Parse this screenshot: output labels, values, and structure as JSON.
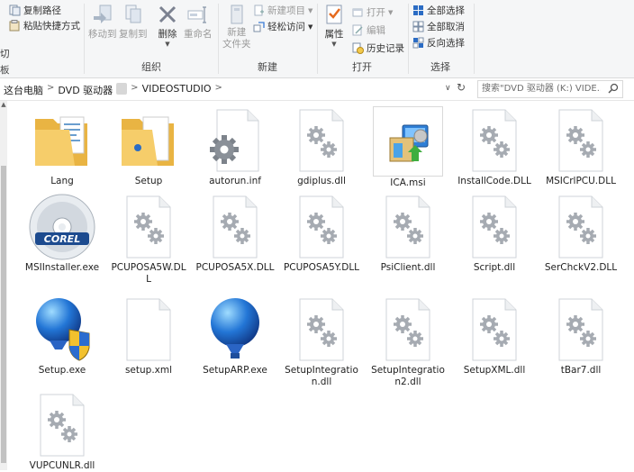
{
  "ribbon": {
    "clipboard": {
      "copy_path": "复制路径",
      "paste_shortcut": "粘贴快捷方式",
      "cut_partial": "切",
      "copy_partial": "板"
    },
    "organize": {
      "label": "组织",
      "move_to": "移动到",
      "copy_to": "复制到",
      "delete": "删除",
      "rename": "重命名"
    },
    "new": {
      "label": "新建",
      "new_folder": "新建\n文件夹",
      "new_item": "新建项目",
      "easy_access": "轻松访问"
    },
    "open": {
      "label": "打开",
      "properties": "属性",
      "open": "打开",
      "edit": "编辑",
      "history": "历史记录"
    },
    "select": {
      "label": "选择",
      "select_all": "全部选择",
      "select_none": "全部取消",
      "invert": "反向选择"
    }
  },
  "address": {
    "crumbs": [
      "这台电脑",
      "DVD 驱动器",
      "VIDEOSTUDIO"
    ],
    "search_placeholder": "搜索\"DVD 驱动器 (K:) VIDE..."
  },
  "files": [
    {
      "name": "Lang",
      "type": "folder-doc"
    },
    {
      "name": "Setup",
      "type": "folder-setup"
    },
    {
      "name": "autorun.inf",
      "type": "gear-large"
    },
    {
      "name": "gdiplus.dll",
      "type": "dll"
    },
    {
      "name": "ICA.msi",
      "type": "msi"
    },
    {
      "name": "InstallCode.DLL",
      "type": "dll"
    },
    {
      "name": "MSICrlPCU.DLL",
      "type": "dll"
    },
    {
      "name": "MSIInstaller.exe",
      "type": "corel-disc"
    },
    {
      "name": "PCUPOSA5W.DLL",
      "type": "dll"
    },
    {
      "name": "PCUPOSA5X.DLL",
      "type": "dll"
    },
    {
      "name": "PCUPOSA5Y.DLL",
      "type": "dll"
    },
    {
      "name": "PsiClient.dll",
      "type": "dll"
    },
    {
      "name": "Script.dll",
      "type": "dll"
    },
    {
      "name": "SerChckV2.DLL",
      "type": "dll"
    },
    {
      "name": "Setup.exe",
      "type": "balloon-shield"
    },
    {
      "name": "setup.xml",
      "type": "blank"
    },
    {
      "name": "SetupARP.exe",
      "type": "balloon"
    },
    {
      "name": "SetupIntegration.dll",
      "type": "dll"
    },
    {
      "name": "SetupIntegration2.dll",
      "type": "dll"
    },
    {
      "name": "SetupXML.dll",
      "type": "dll"
    },
    {
      "name": "tBar7.dll",
      "type": "dll"
    },
    {
      "name": "VUPCUNLR.dll",
      "type": "dll"
    }
  ],
  "colors": {
    "ribbon_bg": "#f5f6f7",
    "folder": "#f3c96a",
    "select_blue": "#2b6cc4",
    "check_orange": "#e66a1e"
  }
}
